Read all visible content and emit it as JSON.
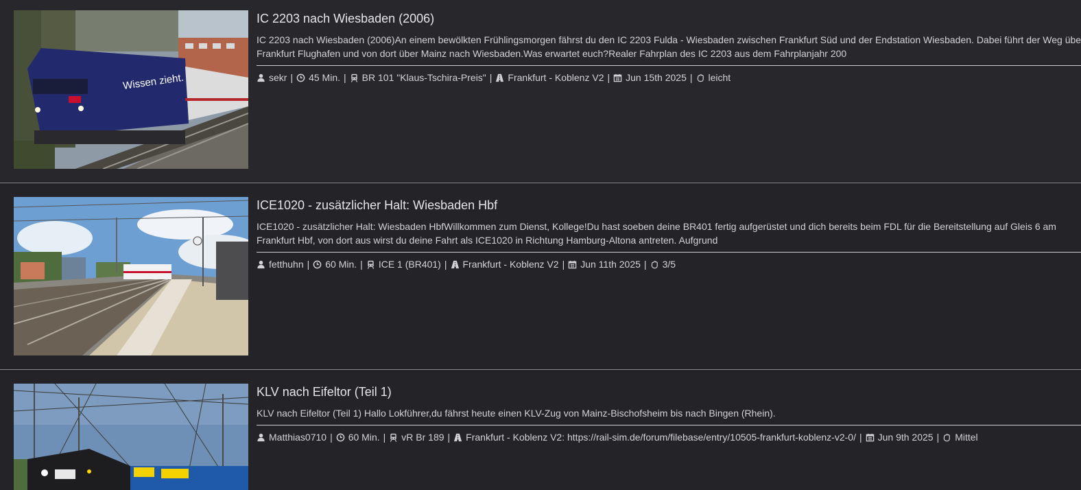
{
  "colors": {
    "background": "#202024",
    "text": "#d6d6d8",
    "separator": "#8a8a8e"
  },
  "entries": [
    {
      "title": "IC 2203 nach Wiesbaden (2006)",
      "description": "IC 2203 nach Wiesbaden (2006)An einem bewölkten Frühlingsmorgen fährst du den IC 2203 Fulda - Wiesbaden zwischen Frankfurt Süd und der Endstation Wiesbaden. Dabei führt der Weg über Frankfurt Flughafen und von dort über Mainz nach Wiesbaden.Was erwartet euch?Realer Fahrplan des IC 2203 aus dem Fahrplanjahr 200",
      "author": "sekr",
      "duration": "45 Min.",
      "train": "BR 101 \"Klaus-Tschira-Preis\"",
      "route": "Frankfurt - Koblenz V2",
      "date": "Jun 15th 2025",
      "difficulty": "leicht",
      "image": "train-image-ic2203"
    },
    {
      "title": "ICE1020 - zusätzlicher Halt: Wiesbaden Hbf",
      "description": "ICE1020 - zusätzlicher Halt: Wiesbaden HbfWillkommen zum Dienst, Kollege!Du hast soeben deine BR401 fertig aufgerüstet und dich bereits beim FDL für die Bereitstellung auf Gleis 6 am Frankfurt Hbf, von dort aus wirst du deine Fahrt als ICE1020 in Richtung Hamburg-Altona antreten. Aufgrund",
      "author": "fetthuhn",
      "duration": "60 Min.",
      "train": "ICE 1 (BR401)",
      "route": "Frankfurt - Koblenz V2",
      "date": "Jun 11th 2025",
      "difficulty": "3/5",
      "image": "train-image-ice1020"
    },
    {
      "title": "KLV nach Eifeltor (Teil 1)",
      "description": "KLV nach Eifeltor (Teil 1) Hallo Lokführer,du fährst heute einen KLV-Zug von Mainz-Bischofsheim bis nach Bingen (Rhein).",
      "author": "Matthias0710",
      "duration": "60 Min.",
      "train": "vR Br 189",
      "route": "Frankfurt - Koblenz V2: https://rail-sim.de/forum/filebase/entry/10505-frankfurt-koblenz-v2-0/",
      "date": "Jun 9th 2025",
      "difficulty": "Mittel",
      "image": "train-image-klv"
    }
  ],
  "meta_separator": "|",
  "icons": {
    "author": "user-icon",
    "duration": "clock-icon",
    "train": "train-icon",
    "route": "road-icon",
    "date": "calendar-icon",
    "difficulty": "hand-icon"
  }
}
